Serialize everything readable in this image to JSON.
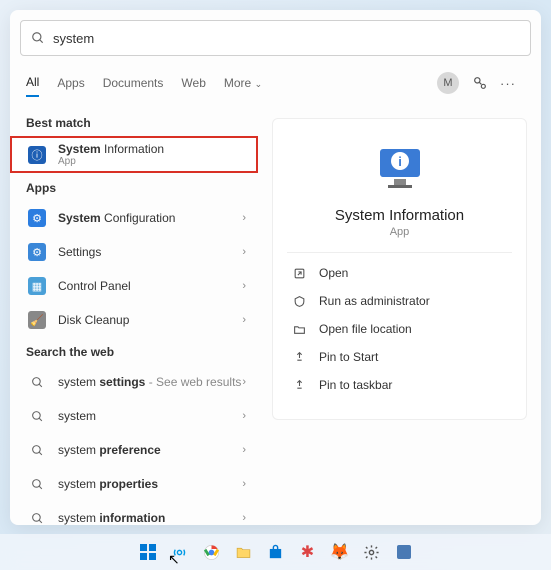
{
  "search": {
    "value": "system",
    "placeholder": ""
  },
  "tabs": {
    "all": "All",
    "apps": "Apps",
    "documents": "Documents",
    "web": "Web",
    "more": "More"
  },
  "avatar_initial": "M",
  "sections": {
    "best_match": "Best match",
    "apps": "Apps",
    "search_web": "Search the web"
  },
  "best_match": {
    "title_pre": "System",
    "title_rest": " Information",
    "sub": "App"
  },
  "apps_list": [
    {
      "pre": "System",
      "rest": " Configuration"
    },
    {
      "pre": "",
      "rest": "Settings"
    },
    {
      "pre": "",
      "rest": "Control Panel"
    },
    {
      "pre": "",
      "rest": "Disk Cleanup"
    }
  ],
  "web_hint": " - See web results",
  "web_list": [
    {
      "pre": "system",
      "rest": " settings",
      "hint": true
    },
    {
      "pre": "system",
      "rest": ""
    },
    {
      "pre": "system",
      "rest": " preference"
    },
    {
      "pre": "system",
      "rest": " properties"
    },
    {
      "pre": "system",
      "rest": " information"
    }
  ],
  "preview": {
    "title": "System Information",
    "sub": "App"
  },
  "actions": {
    "open": "Open",
    "run_admin": "Run as administrator",
    "open_loc": "Open file location",
    "pin_start": "Pin to Start",
    "pin_taskbar": "Pin to taskbar"
  }
}
